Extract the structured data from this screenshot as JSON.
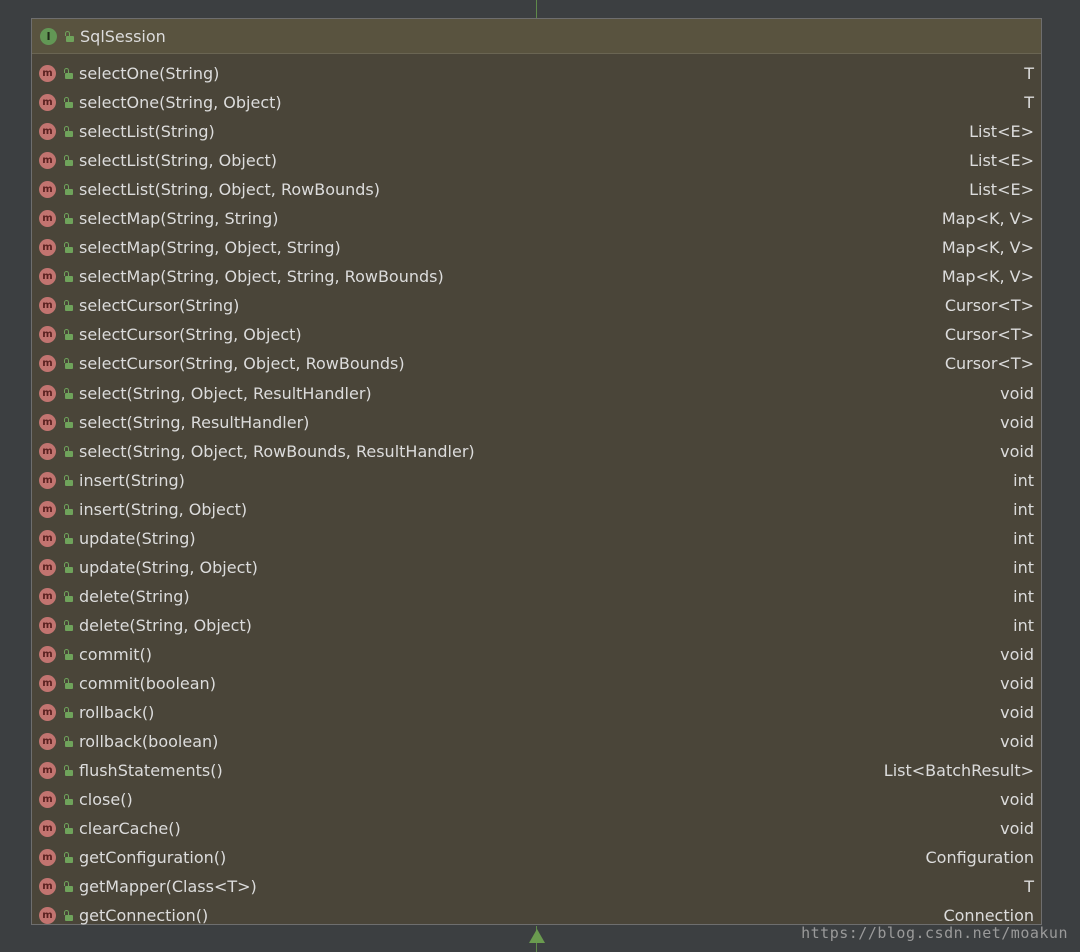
{
  "interface": {
    "name": "SqlSession",
    "badge": "I",
    "icon": "interface-icon"
  },
  "method_badge": "m",
  "methods": [
    {
      "name": "selectOne(String)",
      "returns": "T"
    },
    {
      "name": "selectOne(String, Object)",
      "returns": "T"
    },
    {
      "name": "selectList(String)",
      "returns": "List<E>"
    },
    {
      "name": "selectList(String, Object)",
      "returns": "List<E>"
    },
    {
      "name": "selectList(String, Object, RowBounds)",
      "returns": "List<E>"
    },
    {
      "name": "selectMap(String, String)",
      "returns": "Map<K, V>"
    },
    {
      "name": "selectMap(String, Object, String)",
      "returns": "Map<K, V>"
    },
    {
      "name": "selectMap(String, Object, String, RowBounds)",
      "returns": "Map<K, V>"
    },
    {
      "name": "selectCursor(String)",
      "returns": "Cursor<T>"
    },
    {
      "name": "selectCursor(String, Object)",
      "returns": "Cursor<T>"
    },
    {
      "name": "selectCursor(String, Object, RowBounds)",
      "returns": "Cursor<T>"
    },
    {
      "name": "select(String, Object, ResultHandler)",
      "returns": "void"
    },
    {
      "name": "select(String, ResultHandler)",
      "returns": "void"
    },
    {
      "name": "select(String, Object, RowBounds, ResultHandler)",
      "returns": "void"
    },
    {
      "name": "insert(String)",
      "returns": "int"
    },
    {
      "name": "insert(String, Object)",
      "returns": "int"
    },
    {
      "name": "update(String)",
      "returns": "int"
    },
    {
      "name": "update(String, Object)",
      "returns": "int"
    },
    {
      "name": "delete(String)",
      "returns": "int"
    },
    {
      "name": "delete(String, Object)",
      "returns": "int"
    },
    {
      "name": "commit()",
      "returns": "void"
    },
    {
      "name": "commit(boolean)",
      "returns": "void"
    },
    {
      "name": "rollback()",
      "returns": "void"
    },
    {
      "name": "rollback(boolean)",
      "returns": "void"
    },
    {
      "name": "flushStatements()",
      "returns": "List<BatchResult>"
    },
    {
      "name": "close()",
      "returns": "void"
    },
    {
      "name": "clearCache()",
      "returns": "void"
    },
    {
      "name": "getConfiguration()",
      "returns": "Configuration"
    },
    {
      "name": "getMapper(Class<T>)",
      "returns": "T"
    },
    {
      "name": "getConnection()",
      "returns": "Connection"
    }
  ],
  "watermark": "https://blog.csdn.net/moakun",
  "colors": {
    "background": "#3c3f41",
    "box": "#4a4539",
    "header": "#59533f",
    "text": "#dcdcdc",
    "interface_badge": "#629755",
    "method_badge": "#c27470",
    "lock": "#6fa35b",
    "connector": "#6a9b4f"
  }
}
